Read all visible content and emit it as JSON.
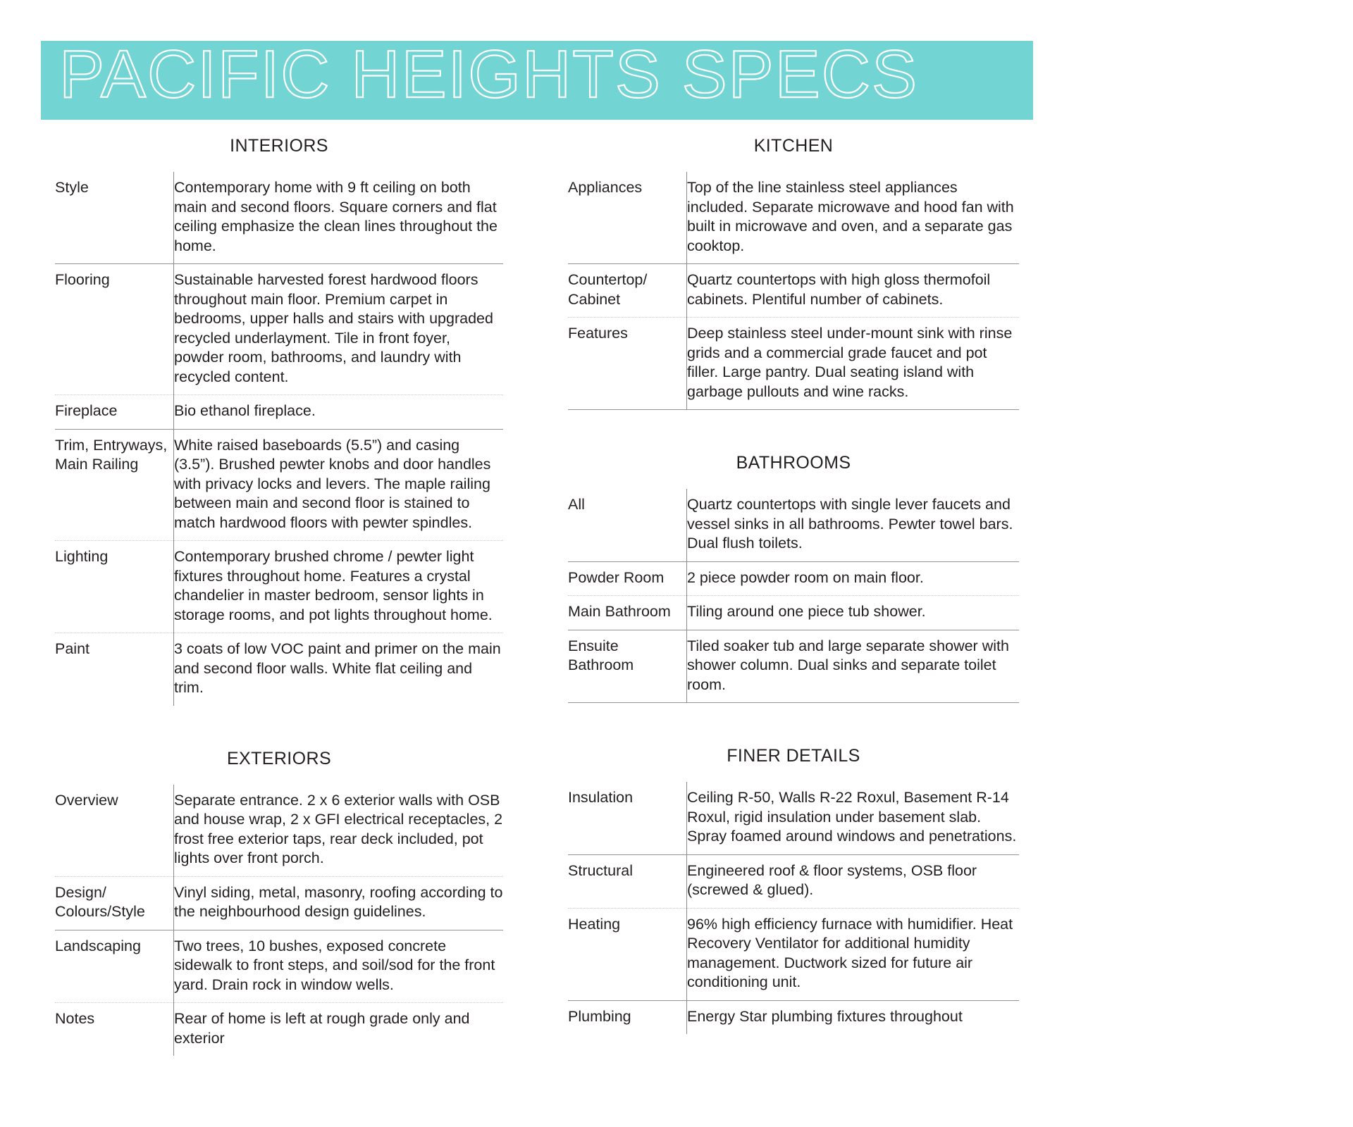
{
  "banner": {
    "title": "PACIFIC HEIGHTS SPECS",
    "bg_color": "#73d4d4",
    "text_color": "#ffffff"
  },
  "sections": {
    "interiors": {
      "title": "INTERIORS",
      "rows": [
        {
          "label": "Style",
          "value": "Contemporary home with 9 ft ceiling on both main and second floors. Square corners and flat ceiling emphasize the clean lines throughout the home."
        },
        {
          "label": "Flooring",
          "value": "Sustainable harvested forest hardwood floors throughout main floor. Premium carpet in bedrooms, upper halls and stairs with upgraded recycled underlayment.  Tile in front foyer, powder room, bathrooms, and laundry with recycled content."
        },
        {
          "label": "Fireplace",
          "value": "Bio ethanol fireplace."
        },
        {
          "label": "Trim, Entryways, Main Railing",
          "value": "White raised baseboards (5.5”) and casing (3.5”). Brushed pewter knobs and door handles with privacy locks and levers. The maple railing between main and second floor is stained to match hardwood floors with pewter spindles."
        },
        {
          "label": "Lighting",
          "value": "Contemporary brushed chrome / pewter light fixtures throughout home. Features a crystal chandelier in master bedroom, sensor lights in storage rooms, and pot lights throughout home."
        },
        {
          "label": "Paint",
          "value": "3 coats of low VOC paint and primer on the main and second floor walls. White flat ceiling and trim."
        }
      ]
    },
    "exteriors": {
      "title": "EXTERIORS",
      "rows": [
        {
          "label": "Overview",
          "value": "Separate entrance. 2 x 6 exterior walls with OSB and house wrap, 2 x GFI electrical receptacles, 2 frost free exterior taps, rear deck included, pot lights over front porch."
        },
        {
          "label": "Design/ Colours/Style",
          "value": "Vinyl siding, metal, masonry, roofing according to the neighbourhood design guidelines."
        },
        {
          "label": "Landscaping",
          "value": "Two trees, 10 bushes, exposed concrete sidewalk to front steps, and soil/sod for the front yard.  Drain rock in window wells."
        },
        {
          "label": "Notes",
          "value": "Rear of home is left at rough grade only and exterior"
        }
      ]
    },
    "kitchen": {
      "title": "KITCHEN",
      "rows": [
        {
          "label": "Appliances",
          "value": "Top of the line stainless steel appliances included. Separate microwave and hood fan with built in microwave and oven, and a separate gas cooktop."
        },
        {
          "label": "Countertop/ Cabinet",
          "value": "Quartz countertops with high gloss thermofoil cabinets. Plentiful number of cabinets."
        },
        {
          "label": "Features",
          "value": "Deep stainless steel under-mount sink with rinse grids and a commercial grade faucet and pot filler. Large pantry. Dual seating island with garbage pullouts and wine racks."
        }
      ]
    },
    "bathrooms": {
      "title": "BATHROOMS",
      "rows": [
        {
          "label": "All",
          "value": "Quartz countertops with single lever faucets and vessel sinks in all bathrooms. Pewter towel bars. Dual flush toilets."
        },
        {
          "label": "Powder Room",
          "value": "2 piece powder room on main floor."
        },
        {
          "label": "Main Bathroom",
          "value": "Tiling around one piece tub shower."
        },
        {
          "label": "Ensuite Bathroom",
          "value": "Tiled soaker tub and large separate shower with shower column. Dual sinks and separate toilet room."
        }
      ]
    },
    "finer_details": {
      "title": "FINER DETAILS",
      "rows": [
        {
          "label": "Insulation",
          "value": "Ceiling R-50, Walls R-22 Roxul, Basement R-14 Roxul, rigid insulation under basement slab. Spray foamed around windows and penetrations."
        },
        {
          "label": "Structural",
          "value": "Engineered roof & floor systems, OSB floor (screwed & glued)."
        },
        {
          "label": "Heating",
          "value": "96% high efficiency furnace with humidifier. Heat Recovery Ventilator for additional humidity management. Ductwork sized for future air conditioning unit."
        },
        {
          "label": "Plumbing",
          "value": "Energy Star plumbing fixtures throughout"
        }
      ]
    }
  }
}
